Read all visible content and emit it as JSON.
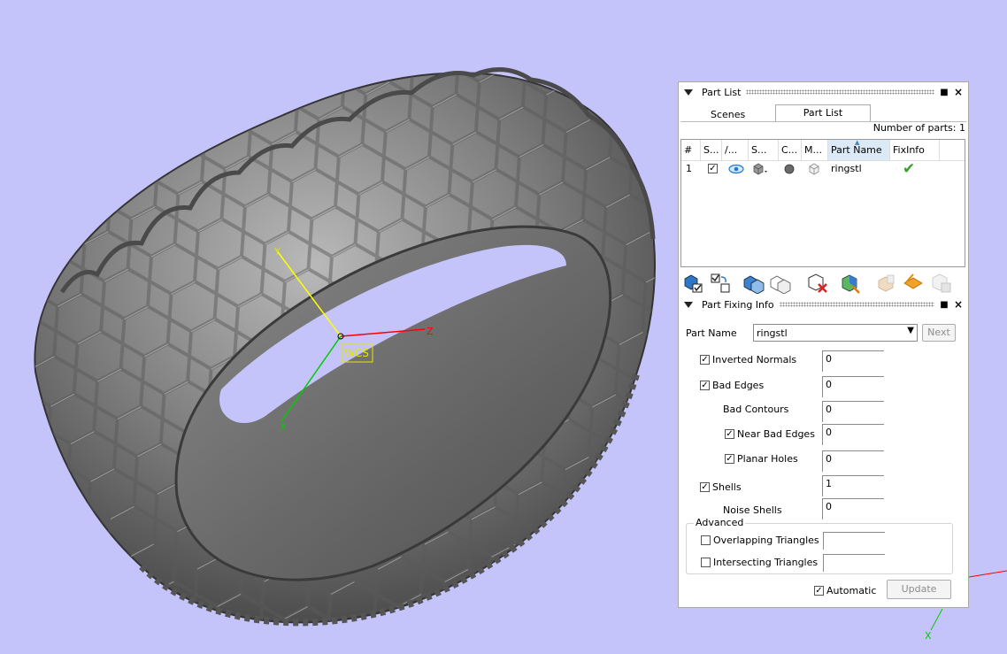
{
  "viewport": {
    "axis_labels": {
      "y": "Y",
      "z": "Z",
      "x": "X"
    },
    "wcs_label": "WCS",
    "corner_axis_label": "X"
  },
  "part_list_panel": {
    "title": "Part List",
    "tabs": [
      "Scenes",
      "Part List"
    ],
    "active_tab": "Part List",
    "count_label": "Number of parts: 1",
    "columns": [
      "#",
      "S...",
      "/...",
      "S...",
      "C...",
      "M...",
      "Part Name",
      "FixInfo"
    ],
    "rows": [
      {
        "index": "1",
        "visible_checked": true,
        "part_name": "ringstl",
        "fixinfo": "ok"
      }
    ],
    "toolbar_icons": [
      "add-part-icon",
      "select-toggle-icon",
      "shell-icon",
      "shell-wireframe-icon",
      "delete-part-icon",
      "fix-part-icon",
      "disabled-export-icon",
      "highlight-icon",
      "disabled-copy-icon"
    ]
  },
  "part_fixing_panel": {
    "title": "Part Fixing Info",
    "part_name_label": "Part Name",
    "part_name_value": "ringstl",
    "next_label": "Next",
    "fields": [
      {
        "label": "Inverted Normals",
        "checked": true,
        "value": "0"
      },
      {
        "label": "Bad Edges",
        "checked": true,
        "value": "0"
      },
      {
        "label": "Bad Contours",
        "checked": null,
        "value": "0"
      },
      {
        "label": "Near Bad Edges",
        "checked": true,
        "value": "0"
      },
      {
        "label": "Planar Holes",
        "checked": true,
        "value": "0"
      },
      {
        "label": "Shells",
        "checked": true,
        "value": "1"
      },
      {
        "label": "Noise Shells",
        "checked": null,
        "value": "0"
      }
    ],
    "advanced": {
      "legend": "Advanced",
      "fields": [
        {
          "label": "Overlapping Triangles",
          "checked": false,
          "value": ""
        },
        {
          "label": "Intersecting Triangles",
          "checked": false,
          "value": ""
        }
      ]
    },
    "automatic_label": "Automatic",
    "automatic_checked": true,
    "update_label": "Update"
  }
}
